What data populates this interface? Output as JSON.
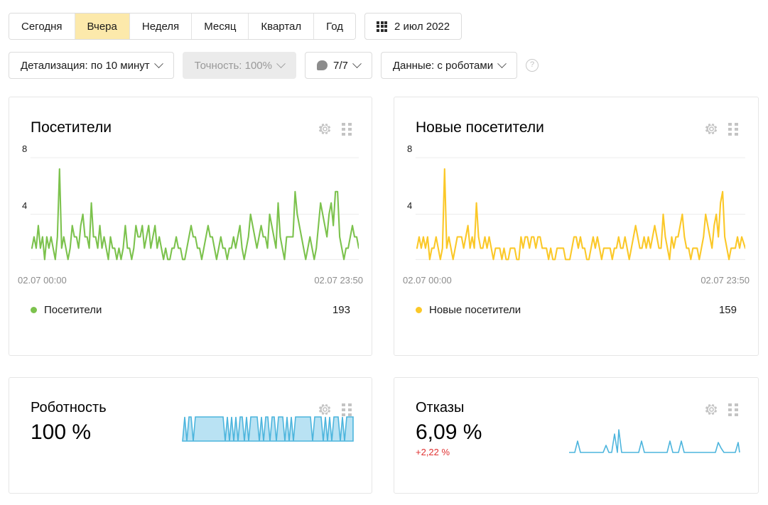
{
  "toolbar": {
    "period_tabs": [
      {
        "label": "Сегодня",
        "active": false
      },
      {
        "label": "Вчера",
        "active": true
      },
      {
        "label": "Неделя",
        "active": false
      },
      {
        "label": "Месяц",
        "active": false
      },
      {
        "label": "Квартал",
        "active": false
      },
      {
        "label": "Год",
        "active": false
      }
    ],
    "date_picker": {
      "icon": "calendar-icon",
      "value": "2 июл 2022"
    },
    "detail_select": {
      "label": "Детализация: по 10 минут",
      "icon": "chevron-down-icon"
    },
    "accuracy_select": {
      "label": "Точность: 100%",
      "icon": "chevron-down-icon",
      "disabled": true
    },
    "comments_select": {
      "label": "7/7",
      "icon": "comment-bubble-icon"
    },
    "data_select": {
      "label": "Данные: с роботами",
      "icon": "chevron-down-icon"
    },
    "help": {
      "label": "?",
      "icon": "help-circle-icon"
    }
  },
  "widgets": {
    "visitors": {
      "title": "Посетители",
      "gear_icon": "gear-icon",
      "grid_icon": "drag-grid-icon",
      "y_ticks": [
        "8",
        "4"
      ],
      "x_start": "02.07 00:00",
      "x_end": "02.07 23:50",
      "legend_label": "Посетители",
      "legend_value": "193",
      "color": "#7cc24d"
    },
    "new_visitors": {
      "title": "Новые посетители",
      "gear_icon": "gear-icon",
      "grid_icon": "drag-grid-icon",
      "y_ticks": [
        "8",
        "4"
      ],
      "x_start": "02.07 00:00",
      "x_end": "02.07 23:50",
      "legend_label": "Новые посетители",
      "legend_value": "159",
      "color": "#fbc828"
    },
    "robotness": {
      "title": "Роботность",
      "gear_icon": "gear-icon",
      "grid_icon": "drag-grid-icon",
      "value": "100 %",
      "color": "#4db5dd"
    },
    "bounces": {
      "title": "Отказы",
      "gear_icon": "gear-icon",
      "grid_icon": "drag-grid-icon",
      "value": "6,09 %",
      "delta": "+2,22 %",
      "delta_color": "#e03131",
      "color": "#4db5dd"
    }
  },
  "chart_data": [
    {
      "type": "line",
      "title": "Посетители",
      "xlabel": "",
      "ylabel": "",
      "ylim": [
        0,
        9
      ],
      "yticks": [
        4,
        8
      ],
      "grid": true,
      "legend": "Посетители",
      "total": 193,
      "color": "#7cc24d",
      "x_tick_labels": [
        "02.07 00:00",
        "02.07 23:50"
      ],
      "values": [
        1,
        2,
        1,
        3,
        1,
        2,
        0,
        2,
        1,
        2,
        1,
        0,
        2,
        8,
        1,
        2,
        1,
        0,
        1,
        3,
        2,
        2,
        1,
        3,
        4,
        2,
        2,
        1,
        5,
        2,
        2,
        1,
        3,
        1,
        2,
        1,
        0,
        2,
        1,
        1,
        0,
        1,
        0,
        1,
        3,
        1,
        1,
        0,
        1,
        3,
        2,
        2,
        3,
        1,
        2,
        3,
        1,
        2,
        3,
        1,
        2,
        1,
        0,
        1,
        0,
        0,
        1,
        1,
        2,
        1,
        1,
        0,
        0,
        1,
        2,
        3,
        2,
        2,
        1,
        1,
        0,
        1,
        2,
        3,
        2,
        2,
        1,
        0,
        1,
        2,
        1,
        1,
        0,
        1,
        1,
        2,
        1,
        2,
        3,
        1,
        0,
        1,
        2,
        4,
        3,
        2,
        1,
        2,
        3,
        2,
        2,
        1,
        4,
        3,
        2,
        1,
        5,
        2,
        1,
        0,
        2,
        2,
        2,
        2,
        6,
        4,
        3,
        2,
        1,
        0,
        1,
        2,
        1,
        0,
        1,
        3,
        5,
        4,
        3,
        2,
        4,
        5,
        3,
        6,
        6,
        2,
        1,
        0,
        1,
        1,
        2,
        3,
        2,
        2,
        1,
        0,
        1,
        3,
        4,
        2,
        1,
        0,
        1,
        4
      ]
    },
    {
      "type": "line",
      "title": "Новые посетители",
      "xlabel": "",
      "ylabel": "",
      "ylim": [
        0,
        9
      ],
      "yticks": [
        4,
        8
      ],
      "grid": true,
      "legend": "Новые посетители",
      "total": 159,
      "color": "#fbc828",
      "x_tick_labels": [
        "02.07 00:00",
        "02.07 23:50"
      ],
      "values": [
        1,
        2,
        1,
        2,
        1,
        2,
        0,
        1,
        1,
        2,
        1,
        0,
        1,
        8,
        1,
        2,
        1,
        0,
        1,
        2,
        2,
        2,
        1,
        2,
        3,
        1,
        2,
        1,
        5,
        2,
        1,
        1,
        2,
        1,
        2,
        1,
        0,
        1,
        1,
        1,
        0,
        1,
        0,
        0,
        1,
        1,
        1,
        0,
        0,
        2,
        1,
        2,
        2,
        1,
        2,
        2,
        1,
        2,
        2,
        1,
        1,
        1,
        0,
        1,
        0,
        0,
        1,
        1,
        1,
        1,
        0,
        0,
        0,
        1,
        2,
        2,
        1,
        2,
        1,
        1,
        0,
        0,
        1,
        2,
        1,
        2,
        1,
        0,
        1,
        1,
        1,
        1,
        0,
        1,
        1,
        2,
        1,
        1,
        2,
        1,
        0,
        1,
        2,
        3,
        2,
        1,
        1,
        1,
        2,
        1,
        2,
        1,
        3,
        2,
        1,
        1,
        4,
        2,
        1,
        0,
        2,
        1,
        2,
        2,
        3,
        4,
        2,
        1,
        1,
        0,
        1,
        1,
        1,
        0,
        1,
        2,
        4,
        3,
        2,
        1,
        3,
        4,
        2,
        5,
        6,
        2,
        1,
        0,
        1,
        1,
        1,
        2,
        1,
        2,
        1,
        0,
        1,
        2,
        3,
        1,
        1,
        0,
        1,
        4
      ]
    },
    {
      "type": "area",
      "title": "Роботность",
      "value": 100,
      "unit": "%",
      "color": "#4db5dd",
      "fill": "#b9e2f3",
      "ylim": [
        0,
        100
      ],
      "values": [
        0,
        100,
        0,
        100,
        100,
        100,
        100,
        100,
        100,
        100,
        100,
        100,
        100,
        100,
        100,
        0,
        100,
        0,
        100,
        0,
        100,
        0,
        100,
        100,
        0,
        100,
        0,
        100,
        100,
        100,
        100,
        0,
        100,
        0,
        100,
        100,
        0,
        100,
        100,
        0,
        100,
        100,
        100,
        0,
        100,
        0,
        100,
        0,
        100,
        100,
        100,
        100,
        100,
        100,
        100,
        100,
        0,
        100,
        100,
        100,
        100,
        0,
        100,
        0,
        100,
        0,
        100,
        100,
        100,
        100,
        0,
        100,
        100,
        100,
        0,
        100,
        100
      ]
    },
    {
      "type": "line",
      "title": "Отказы",
      "value": 6.09,
      "unit": "%",
      "delta": 2.22,
      "color": "#4db5dd",
      "ylim": [
        0,
        100
      ],
      "values": [
        0,
        0,
        0,
        0,
        30,
        0,
        0,
        0,
        0,
        0,
        0,
        0,
        0,
        0,
        18,
        0,
        55,
        62,
        0,
        0,
        0,
        0,
        0,
        0,
        0,
        26,
        0,
        0,
        0,
        0,
        0,
        0,
        0,
        0,
        0,
        28,
        0,
        0,
        30,
        0,
        0,
        0,
        0,
        0,
        0,
        0,
        0,
        0,
        0,
        0,
        0,
        0,
        0,
        0,
        0,
        0,
        0,
        0,
        0,
        0,
        0,
        0,
        0,
        26,
        12,
        0,
        0,
        0,
        0,
        22,
        0
      ]
    }
  ]
}
